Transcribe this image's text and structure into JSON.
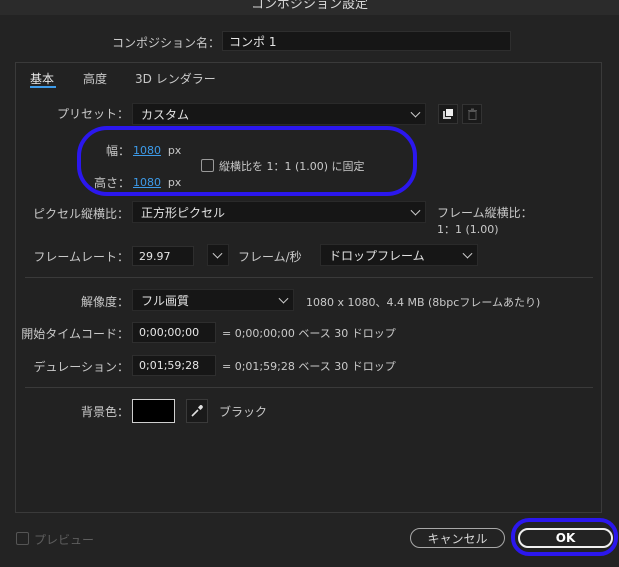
{
  "window": {
    "title": "コンポジション設定"
  },
  "name_row": {
    "label": "コンポジション名：",
    "value": "コンポ 1"
  },
  "tabs": [
    {
      "label": "基本"
    },
    {
      "label": "高度"
    },
    {
      "label": "3D レンダラー"
    }
  ],
  "preset": {
    "label": "プリセット：",
    "value": "カスタム",
    "save_icon": "save-preset-icon",
    "delete_icon": "trash-icon"
  },
  "size": {
    "width_label": "幅：",
    "width_value": "1080",
    "width_unit": "px",
    "height_label": "高さ：",
    "height_value": "1080",
    "height_unit": "px",
    "lock_label": "縦横比を 1：1 (1.00) に固定"
  },
  "pixel_aspect": {
    "label": "ピクセル縦横比：",
    "value": "正方形ピクセル",
    "frame_aspect_label": "フレーム縦横比：",
    "frame_aspect_value": "1：1 (1.00)"
  },
  "frame_rate": {
    "label": "フレームレート：",
    "value": "29.97",
    "unit": "フレーム/秒",
    "drop_value": "ドロップフレーム"
  },
  "resolution": {
    "label": "解像度：",
    "value": "フル画質",
    "info": "1080 x 1080、4.4 MB (8bpcフレームあたり)"
  },
  "start_timecode": {
    "label": "開始タイムコード：",
    "value": "0;00;00;00",
    "info": "= 0;00;00;00  ベース 30   ドロップ"
  },
  "duration": {
    "label": "デュレーション：",
    "value": "0;01;59;28",
    "info": "= 0;01;59;28  ベース 30   ドロップ"
  },
  "background": {
    "label": "背景色：",
    "color": "#000000",
    "name": "ブラック",
    "eyedropper_icon": "eyedropper-icon"
  },
  "footer": {
    "preview_label": "プレビュー",
    "cancel_label": "キャンセル",
    "ok_label": "OK"
  },
  "colors": {
    "accent": "#3d9be9",
    "highlight": "#2b17ee",
    "background": "#232323"
  }
}
